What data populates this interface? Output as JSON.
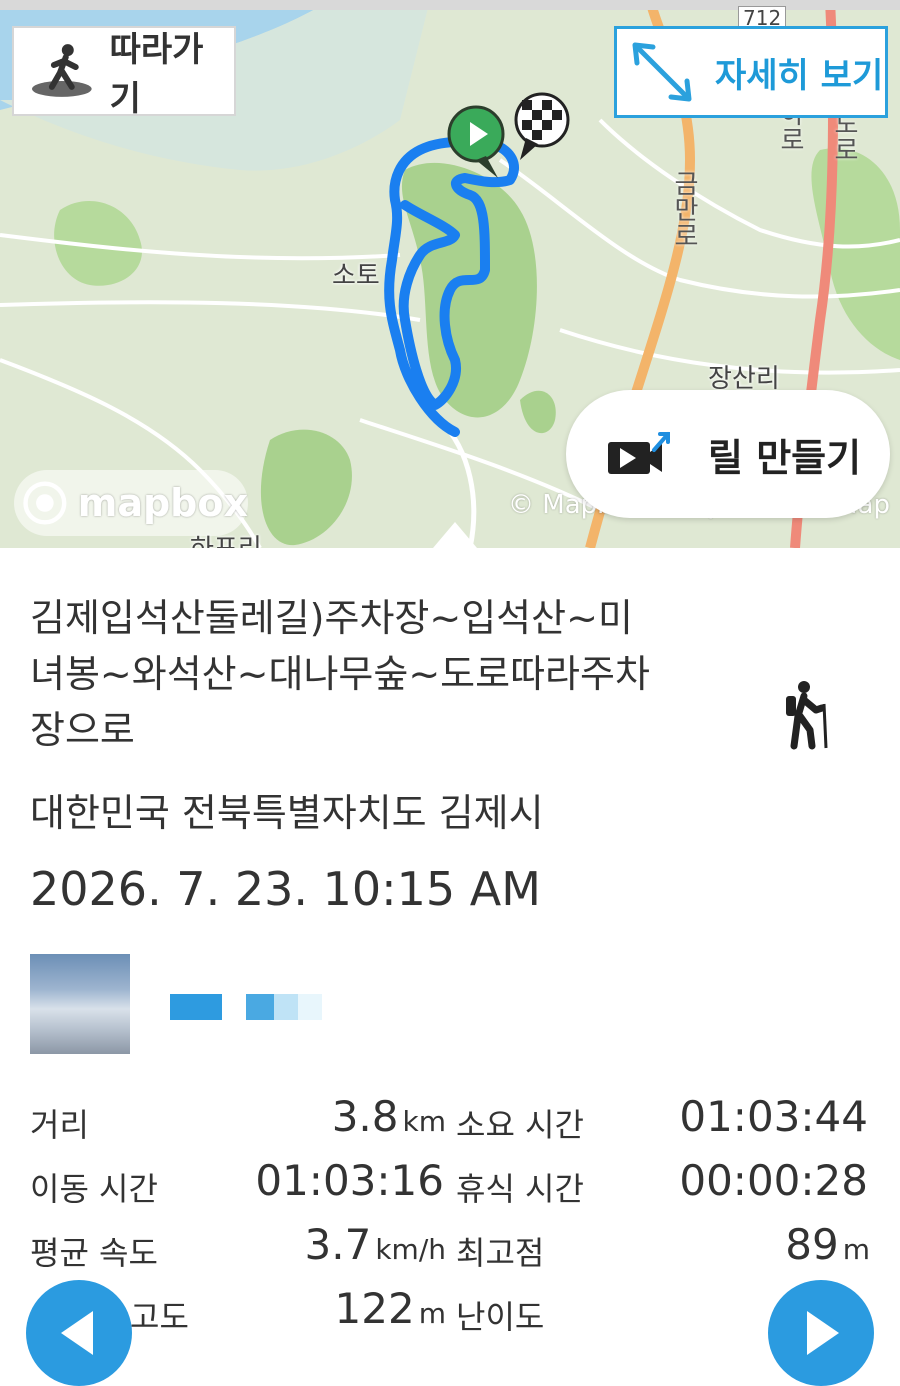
{
  "map": {
    "follow_label": "따라가기",
    "detail_label": "자세히 보기",
    "reel_label": "릴 만들기",
    "logo_text": "mapbox",
    "attribution": "© Mapbox © OpenStreetMap",
    "labels": {
      "village_1": "소토",
      "village_2": "장산리",
      "road_1": "금만로",
      "road_2": "하로",
      "road_3": "도로",
      "road_num": "712",
      "bottom_label": "하포리"
    },
    "route_color": "#1a7ff0"
  },
  "trail": {
    "title": "김제입석산둘레길)주차장~입석산~미녀봉~와석산~대나무숲~도로따라주차장으로",
    "location": "대한민국 전북특별자치도 김제시",
    "datetime": "2026. 7. 23. 10:15 AM",
    "activity_icon": "hiker-icon"
  },
  "stats": {
    "distance_label": "거리",
    "distance_value": "3.8",
    "distance_unit": "km",
    "total_time_label": "소요 시간",
    "total_time_value": "01:03:44",
    "moving_time_label": "이동 시간",
    "moving_time_value": "01:03:16",
    "rest_time_label": "휴식 시간",
    "rest_time_value": "00:00:28",
    "avg_speed_label": "평균 속도",
    "avg_speed_value": "3.7",
    "avg_speed_unit": "km/h",
    "max_alt_label": "최고점",
    "max_alt_value": "89",
    "max_alt_unit": "m",
    "gain_label": "고도",
    "gain_value": "122",
    "gain_unit": "m",
    "difficulty_label": "난이도"
  },
  "colors": {
    "accent": "#2b9be0",
    "route": "#1a7ff0",
    "start": "#3aaa5a"
  }
}
